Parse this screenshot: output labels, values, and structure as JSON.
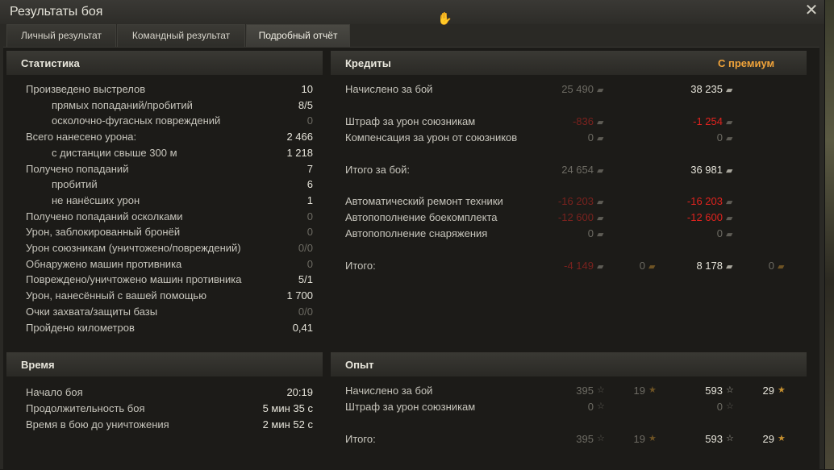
{
  "window": {
    "title": "Результаты боя"
  },
  "tabs": [
    {
      "label": "Личный результат",
      "active": false
    },
    {
      "label": "Командный результат",
      "active": false
    },
    {
      "label": "Подробный отчёт",
      "active": true
    }
  ],
  "stats": {
    "header": "Статистика",
    "rows": [
      {
        "label": "Произведено выстрелов",
        "value": "10",
        "dim": false
      },
      {
        "label": "прямых попаданий/пробитий",
        "value": "8/5",
        "dim": false
      },
      {
        "label": "осколочно-фугасных повреждений",
        "value": "0",
        "dim": true
      },
      {
        "label": "Всего нанесено урона:",
        "value": "2 466",
        "dim": false
      },
      {
        "label": "с дистанции свыше 300 м",
        "value": "1 218",
        "dim": false
      },
      {
        "label": "Получено попаданий",
        "value": "7",
        "dim": false
      },
      {
        "label": "пробитий",
        "value": "6",
        "dim": false
      },
      {
        "label": "не нанёсших урон",
        "value": "1",
        "dim": false
      },
      {
        "label": "Получено попаданий осколками",
        "value": "0",
        "dim": true
      },
      {
        "label": "Урон, заблокированный бронёй",
        "value": "0",
        "dim": true
      },
      {
        "label": "Урон союзникам (уничтожено/повреждений)",
        "value": "0/0",
        "dim": true
      },
      {
        "label": "Обнаружено машин противника",
        "value": "0",
        "dim": true
      },
      {
        "label": "Повреждено/уничтожено машин противника",
        "value": "5/1",
        "dim": false
      },
      {
        "label": "Урон, нанесённый с вашей помощью",
        "value": "1 700",
        "dim": false
      },
      {
        "label": "Очки захвата/защиты базы",
        "value": "0/0",
        "dim": true
      },
      {
        "label": "Пройдено километров",
        "value": "0,41",
        "dim": false
      }
    ]
  },
  "time": {
    "header": "Время",
    "rows": [
      {
        "label": "Начало боя",
        "value": "20:19"
      },
      {
        "label": "Продолжительность боя",
        "value": "5 мин 35 с"
      },
      {
        "label": "Время в бою до уничтожения",
        "value": "2 мин 52 с"
      }
    ]
  },
  "credits": {
    "header": "Кредиты",
    "premium_label": "С премиум",
    "icon": "credits-icon",
    "rows": [
      {
        "label": "Начислено за бой",
        "base": "25 490",
        "prem": "38 235",
        "base_style": "dim",
        "prem_style": "normal"
      },
      {
        "label": "Штраф за урон союзникам",
        "base": "-836",
        "prem": "-1 254",
        "base_style": "reddim",
        "prem_style": "red"
      },
      {
        "label": "Компенсация за урон от союзников",
        "base": "0",
        "prem": "0",
        "base_style": "dim",
        "prem_style": "dim"
      },
      {
        "label": "Итого за бой:",
        "base": "24 654",
        "prem": "36 981",
        "base_style": "dim",
        "prem_style": "normal"
      },
      {
        "label": "Автоматический ремонт техники",
        "base": "-16 203",
        "prem": "-16 203",
        "base_style": "reddim",
        "prem_style": "red"
      },
      {
        "label": "Автопополнение боекомплекта",
        "base": "-12 600",
        "prem": "-12 600",
        "base_style": "reddim",
        "prem_style": "red"
      },
      {
        "label": "Автопополнение снаряжения",
        "base": "0",
        "prem": "0",
        "base_style": "dim",
        "prem_style": "dim"
      },
      {
        "label": "Итого:",
        "base": "-4 149",
        "base_gold": "0",
        "prem": "8 178",
        "prem_gold": "0",
        "base_style": "reddim",
        "prem_style": "normal"
      }
    ]
  },
  "experience": {
    "header": "Опыт",
    "icon": "star-icon",
    "rows": [
      {
        "label": "Начислено за бой",
        "base": "395",
        "base_free": "19",
        "prem": "593",
        "prem_free": "29"
      },
      {
        "label": "Штраф за урон союзникам",
        "base": "0",
        "prem": "0"
      },
      {
        "label": "Итого:",
        "base": "395",
        "base_free": "19",
        "prem": "593",
        "prem_free": "29"
      }
    ]
  }
}
